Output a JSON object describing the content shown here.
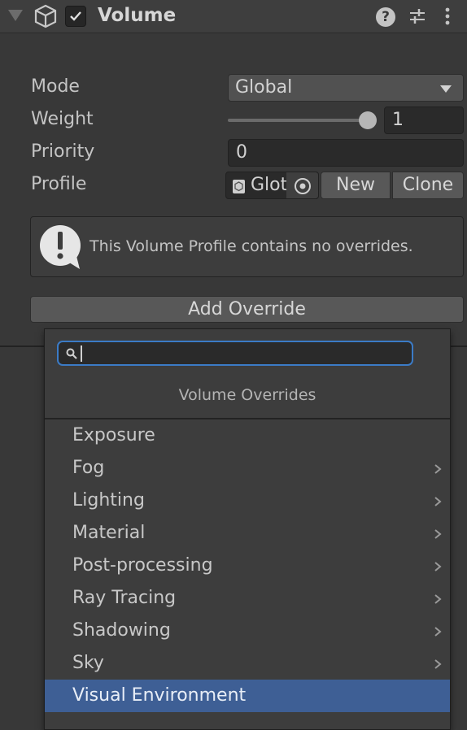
{
  "header": {
    "title": "Volume",
    "enabled": true,
    "icons": [
      "foldout-triangle-icon",
      "cube-icon",
      "checkbox-icon",
      "help-icon",
      "presets-icon",
      "kebab-menu-icon"
    ]
  },
  "properties": {
    "mode": {
      "label": "Mode",
      "value": "Global"
    },
    "weight": {
      "label": "Weight",
      "value": "1",
      "slider_fraction": 1.0
    },
    "priority": {
      "label": "Priority",
      "value": "0"
    },
    "profile": {
      "label": "Profile",
      "value": "Glot",
      "new_label": "New",
      "clone_label": "Clone"
    }
  },
  "help_box": {
    "text": "This Volume Profile contains no overrides.",
    "icon": "warning-icon"
  },
  "add_override_label": "Add Override",
  "menu": {
    "search_value": "",
    "title": "Volume Overrides",
    "items": [
      {
        "label": "Exposure",
        "has_submenu": false
      },
      {
        "label": "Fog",
        "has_submenu": true
      },
      {
        "label": "Lighting",
        "has_submenu": true
      },
      {
        "label": "Material",
        "has_submenu": true
      },
      {
        "label": "Post-processing",
        "has_submenu": true
      },
      {
        "label": "Ray Tracing",
        "has_submenu": true
      },
      {
        "label": "Shadowing",
        "has_submenu": true
      },
      {
        "label": "Sky",
        "has_submenu": true
      },
      {
        "label": "Visual Environment",
        "has_submenu": false,
        "selected": true
      }
    ]
  },
  "colors": {
    "background": "#383838",
    "selection": "#3e5f95",
    "search_focus": "#3b7bc6"
  }
}
